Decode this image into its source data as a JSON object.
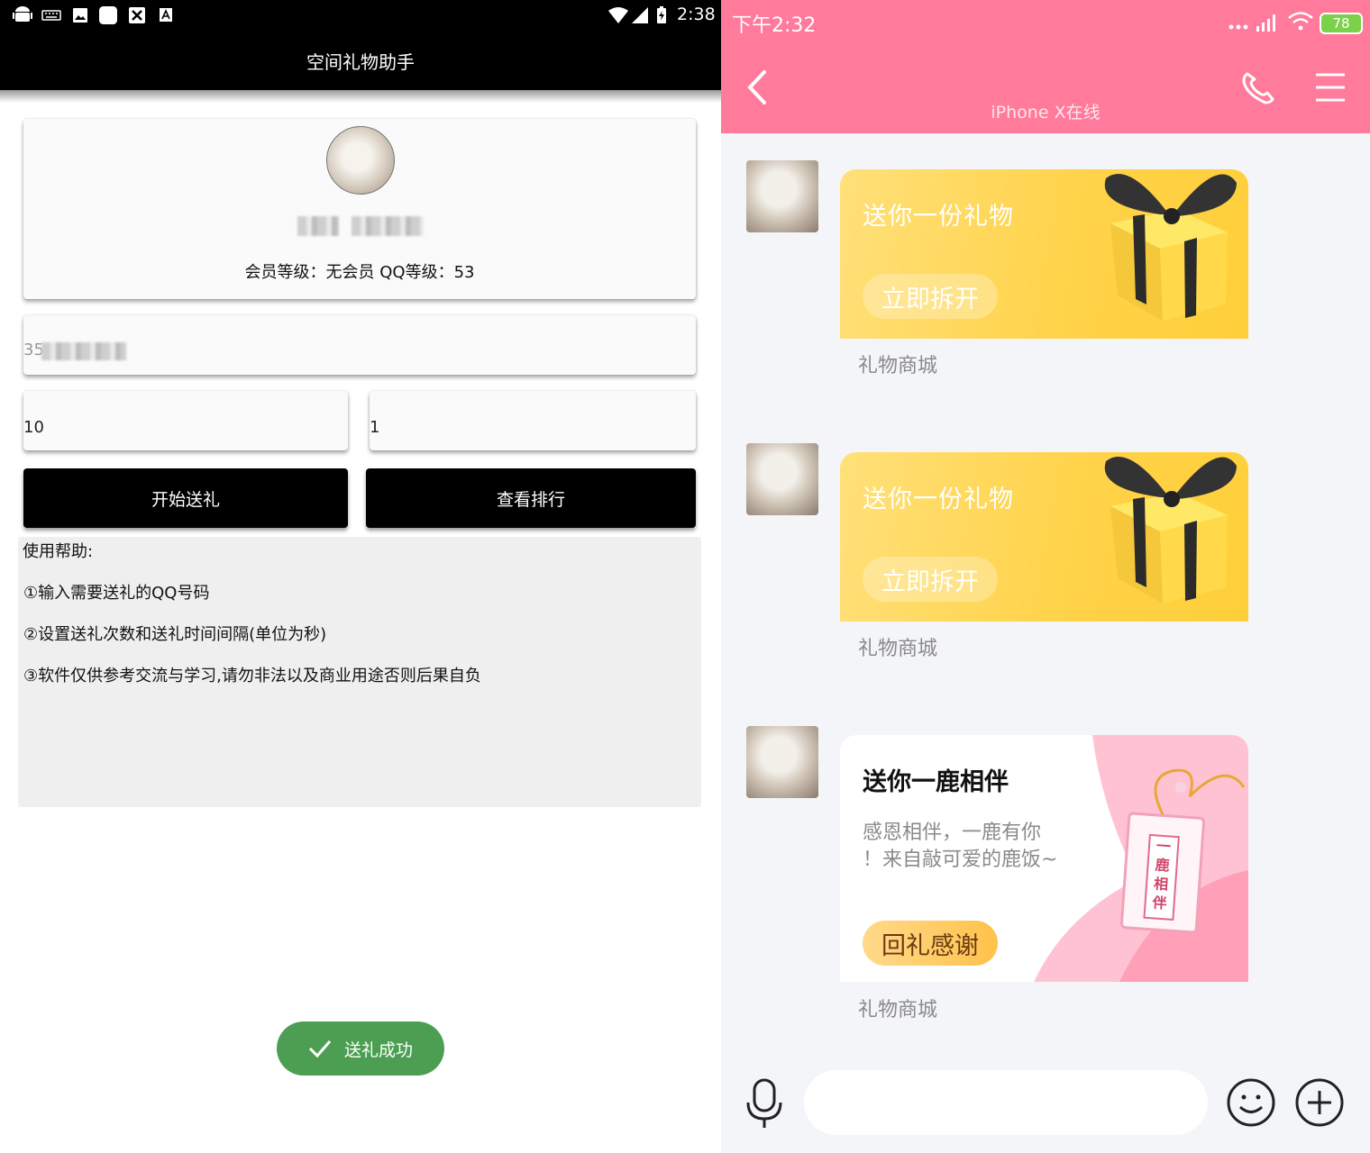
{
  "left_app": {
    "status_bar": {
      "time": "2:38"
    },
    "app_title": "空间礼物助手",
    "profile": {
      "info_prefix_member": "会员等级：",
      "member_level": "无会员",
      "qq_level_label": "QQ等级：",
      "qq_level": "53"
    },
    "target_qq_field": {
      "value_visible": "35"
    },
    "send_count_field": {
      "value": "10"
    },
    "interval_field": {
      "value": "1"
    },
    "buttons": {
      "start": "开始送礼",
      "ranking": "查看排行"
    },
    "help": {
      "title": "使用帮助:",
      "lines": [
        "①输入需要送礼的QQ号码",
        "②设置送礼次数和送礼时间间隔(单位为秒)",
        "③软件仅供参考交流与学习,请勿非法以及商业用途否则后果自负"
      ]
    },
    "toast": {
      "text": "送礼成功",
      "icon": "check-icon",
      "color": "#4c9f52"
    }
  },
  "right_chat": {
    "status_bar": {
      "time": "下午2:32",
      "battery": "78"
    },
    "header": {
      "subtitle": "iPhone X在线",
      "color": "#ff7a9b"
    },
    "messages": [
      {
        "title": "送你一份礼物",
        "button": "立即拆开",
        "source": "礼物商城"
      },
      {
        "title": "送你一份礼物",
        "button": "立即拆开",
        "source": "礼物商城"
      }
    ],
    "deer_message": {
      "title": "送你一鹿相伴",
      "desc_line1": "感恩相伴，一鹿有你",
      "desc_line2": "！来自敲可爱的鹿饭~",
      "button": "回礼感谢",
      "charm_text": [
        "一",
        "鹿",
        "相",
        "伴"
      ],
      "source": "礼物商城"
    }
  }
}
